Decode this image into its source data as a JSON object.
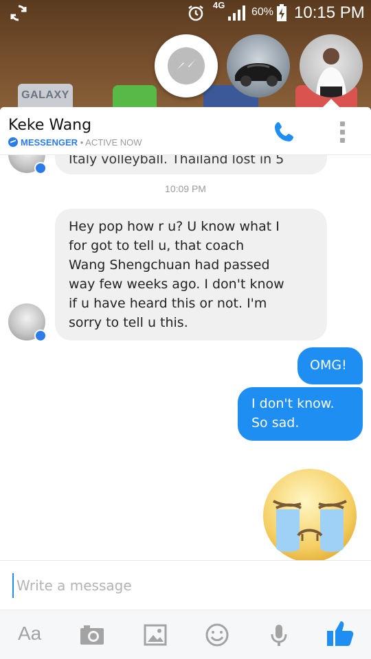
{
  "status_bar": {
    "network": "4G",
    "battery_percent": "60%",
    "time": "10:15 PM"
  },
  "wallpaper": {
    "galaxy_label": "GALAXY"
  },
  "chat_heads": [
    {
      "name": "messenger-chathead"
    },
    {
      "name": "car-avatar"
    },
    {
      "name": "person-avatar"
    }
  ],
  "header": {
    "contact_name": "Keke Wang",
    "app_label": "MESSENGER",
    "separator": "•",
    "presence": "ACTIVE NOW"
  },
  "messages": {
    "partial_text": "Italy volleyball. Thailand lost in 5",
    "timestamp": "10:09 PM",
    "incoming_lines": [
      "Hey pop how r u? U know what I",
      "for got to tell u, that coach",
      "Wang Shengchuan had passed",
      "way few weeks ago. I don't know",
      "if u have heard this or not. I'm",
      "sorry to tell u this."
    ],
    "outgoing_1": "OMG!",
    "outgoing_2_lines": [
      "I don't know.",
      "So sad."
    ]
  },
  "composer": {
    "placeholder": "Write a message"
  },
  "toolbar": {
    "text_label": "Aa"
  },
  "colors": {
    "accent": "#1f8ef3",
    "messenger_blue": "#2b7bea",
    "incoming_bubble": "#f1f0f0"
  }
}
